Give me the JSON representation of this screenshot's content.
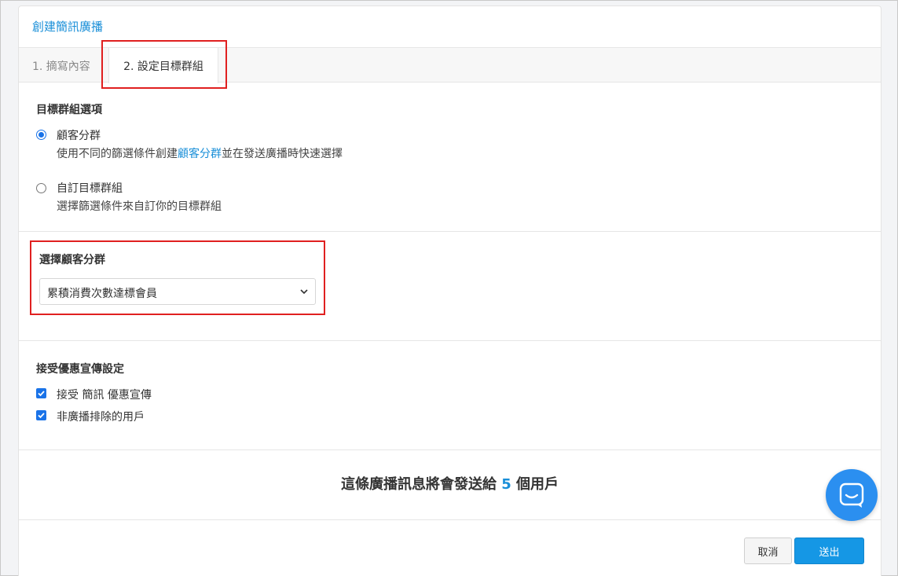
{
  "card": {
    "title": "創建簡訊廣播"
  },
  "tabs": [
    {
      "label": "1. 摘寫內容",
      "active": false
    },
    {
      "label": "2. 設定目標群組",
      "active": true
    }
  ],
  "target_options": {
    "title": "目標群組選項",
    "options": [
      {
        "title": "顧客分群",
        "desc_before": "使用不同的篩選條件創建",
        "desc_link": "顧客分群",
        "desc_after": "並在發送廣播時快速選擇",
        "selected": true
      },
      {
        "title": "自訂目標群組",
        "desc": "選擇篩選條件來自訂你的目標群組",
        "selected": false
      }
    ]
  },
  "segment": {
    "title": "選擇顧客分群",
    "selected_value": "累積消費次數達標會員"
  },
  "promo": {
    "title": "接受優惠宣傳設定",
    "checkboxes": [
      {
        "label": "接受 簡訊 優惠宣傳",
        "checked": true
      },
      {
        "label": "非廣播排除的用戶",
        "checked": true
      }
    ]
  },
  "summary": {
    "before": "這條廣播訊息將會發送給 ",
    "count": "5",
    "after": " 個用戶"
  },
  "buttons": {
    "cancel": "取消",
    "send": "送出"
  },
  "colors": {
    "accent": "#1a8fd8",
    "highlight": "#e02020",
    "primary_button": "#1597e5"
  },
  "icons": {
    "chat": "chat-bubble-icon",
    "select": "chevron-down-icon",
    "check": "checkmark-icon"
  }
}
